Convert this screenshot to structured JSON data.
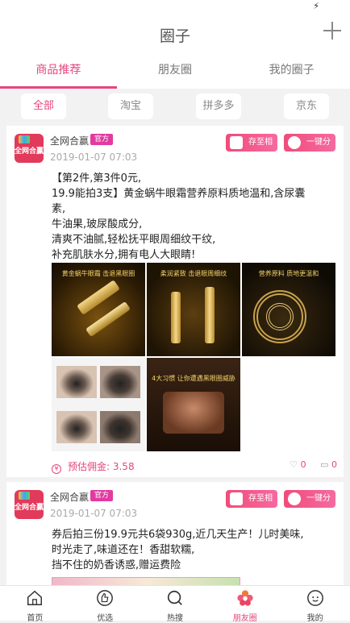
{
  "status_bar": {
    "charging_icon": "bolt-icon"
  },
  "header": {
    "title": "圈子",
    "add_icon": "plus-icon"
  },
  "tabs": [
    {
      "label": "商品推荐",
      "active": true
    },
    {
      "label": "朋友圈",
      "active": false
    },
    {
      "label": "我的圈子",
      "active": false
    }
  ],
  "filters": [
    {
      "label": "全部",
      "active": true
    },
    {
      "label": "淘宝",
      "active": false
    },
    {
      "label": "拼多多",
      "active": false
    },
    {
      "label": "京东",
      "active": false
    }
  ],
  "posts": [
    {
      "shop_name": "全网合赢",
      "badge": "官方",
      "avatar_text": "全网合赢",
      "date": "2019-01-07 07:03",
      "save_label": "存至相册",
      "share_label": "一键分享",
      "lines": [
        "【第2件,第3件0元,",
        "19.9能拍3支】黄金蜗牛眼霜营养原料质地温和,含尿囊素,",
        "牛油果,玻尿酸成分,",
        "清爽不油腻,轻松抚平眼周细纹干纹,",
        "补充肌肤水分,拥有电人大眼睛!"
      ],
      "images": [
        {
          "caption": "黄金蜗牛眼霜 击退黑眼圈",
          "theme": "gold"
        },
        {
          "caption": "柔润紧致 击退眼周细纹",
          "theme": "gold"
        },
        {
          "caption": "营养原料 质地更温和",
          "theme": "shell"
        },
        {
          "caption": "",
          "theme": "eyes"
        },
        {
          "caption": "4大习惯 让你遭遇黑眼圈威胁",
          "theme": "brown"
        }
      ],
      "commission_label": "预估佣金: 3.58",
      "likes": "0",
      "comments": "0"
    },
    {
      "shop_name": "全网合赢",
      "badge": "官方",
      "avatar_text": "全网合赢",
      "date": "2019-01-07 07:03",
      "save_label": "存至相册",
      "share_label": "一键分享",
      "lines": [
        "券后拍三份19.9元共6袋930g,近几天生产！儿时美味,",
        "时光走了,味道还在！香甜软糯,",
        "挡不住的奶香诱惑,赠运费险"
      ]
    }
  ],
  "tabbar": [
    {
      "label": "首页",
      "icon": "home-icon",
      "active": false
    },
    {
      "label": "优选",
      "icon": "thumbs-up-icon",
      "active": false
    },
    {
      "label": "热搜",
      "icon": "search-icon",
      "active": false
    },
    {
      "label": "朋友圈",
      "icon": "flower-icon",
      "active": true
    },
    {
      "label": "我的",
      "icon": "profile-icon",
      "active": false
    }
  ],
  "colors": {
    "accent": "#e7457f",
    "badge": "#e23aa0",
    "background": "#f2f2f2"
  }
}
